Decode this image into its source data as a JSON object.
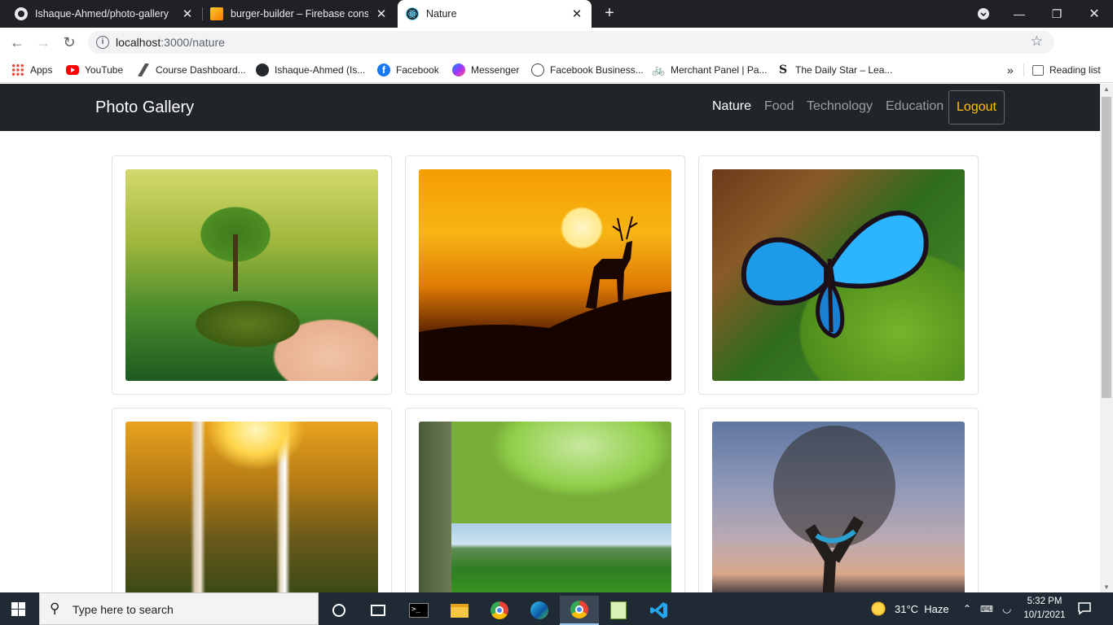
{
  "browser": {
    "tabs": [
      {
        "title": "Ishaque-Ahmed/photo-gallery",
        "icon": "github-icon"
      },
      {
        "title": "burger-builder – Firebase console",
        "icon": "firebase-icon"
      },
      {
        "title": "Nature",
        "icon": "react-icon",
        "active": true
      }
    ],
    "new_tab_label": "+",
    "close_label": "✕",
    "url_host": "localhost",
    "url_rest": ":3000/nature",
    "bookmarks": [
      {
        "label": "Apps",
        "icon": "apps-grid-icon"
      },
      {
        "label": "YouTube",
        "icon": "youtube-icon"
      },
      {
        "label": "Course Dashboard...",
        "icon": "course-icon"
      },
      {
        "label": "Ishaque-Ahmed (Is...",
        "icon": "github-icon"
      },
      {
        "label": "Facebook",
        "icon": "facebook-icon"
      },
      {
        "label": "Messenger",
        "icon": "messenger-icon"
      },
      {
        "label": "Facebook Business...",
        "icon": "facebook-business-icon"
      },
      {
        "label": "Merchant Panel | Pa...",
        "icon": "bicycle-icon"
      },
      {
        "label": "The Daily Star – Lea...",
        "icon": "daily-star-icon"
      }
    ],
    "more_bookmarks": "»",
    "reading_list": "Reading list"
  },
  "app": {
    "brand": "Photo Gallery",
    "nav": [
      {
        "label": "Nature",
        "active": true
      },
      {
        "label": "Food"
      },
      {
        "label": "Technology"
      },
      {
        "label": "Education"
      }
    ],
    "logout": "Logout",
    "gallery": [
      {
        "alt": "tree in hand",
        "theme": "tree-hand"
      },
      {
        "alt": "deer at sunset",
        "theme": "deer-sunset"
      },
      {
        "alt": "blue butterfly",
        "theme": "butterfly"
      },
      {
        "alt": "forest waterfall",
        "theme": "waterfall"
      },
      {
        "alt": "tree and green valley",
        "theme": "valley"
      },
      {
        "alt": "tree with hammock at dusk",
        "theme": "hammock"
      }
    ]
  },
  "taskbar": {
    "search_placeholder": "Type here to search",
    "weather": "31°C  Haze",
    "time": "5:32 PM",
    "date": "10/1/2021"
  }
}
